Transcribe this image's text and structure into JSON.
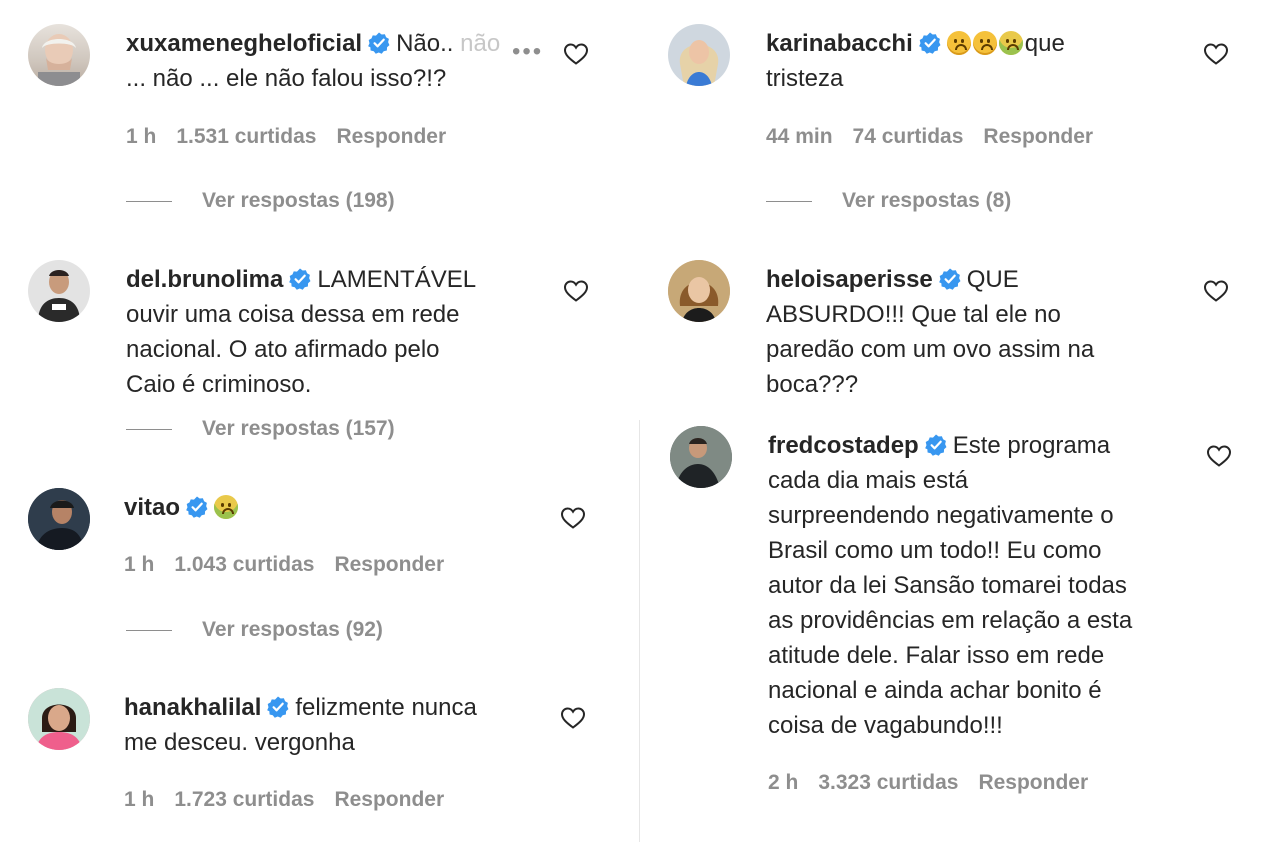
{
  "left": [
    {
      "username": "xuxamenegheloficial",
      "text_line1": "Não..",
      "text_faded": "não",
      "text_line2": "... não ... ele não falou isso?!?",
      "time": "1 h",
      "likes": "1.531 curtidas",
      "reply": "Responder",
      "replies": "Ver respostas (198)"
    },
    {
      "username": "del.brunolima",
      "text_line1": "LAMENTÁVEL",
      "text_line2": "ouvir uma coisa dessa em rede",
      "text_line3": "nacional. O ato afirmado pelo",
      "text_line4": "Caio é criminoso.",
      "replies": "Ver respostas (157)"
    },
    {
      "username": "vitao",
      "time": "1 h",
      "likes": "1.043 curtidas",
      "reply": "Responder",
      "replies": "Ver respostas (92)"
    },
    {
      "username": "hanakhalilal",
      "text_line1": "felizmente nunca",
      "text_line2": "me desceu. vergonha",
      "time": "1 h",
      "likes": "1.723 curtidas",
      "reply": "Responder"
    }
  ],
  "right": [
    {
      "username": "karinabacchi",
      "text_line1": "que",
      "text_line2": "tristeza",
      "time": "44 min",
      "likes": "74 curtidas",
      "reply": "Responder",
      "replies": "Ver respostas (8)"
    },
    {
      "username": "heloisaperisse",
      "text_line1": "QUE",
      "text_line2": "ABSURDO!!! Que tal ele no",
      "text_line3": "paredão com um ovo assim na",
      "text_line4": "boca???"
    },
    {
      "username": "fredcostadep",
      "text_line1": "Este programa",
      "text_line2": "cada dia mais está",
      "text_line3": "surpreendendo negativamente o",
      "text_line4": "Brasil como um todo!! Eu como",
      "text_line5": "autor da lei Sansão tomarei todas",
      "text_line6": "as providências em relação a esta",
      "text_line7": "atitude dele. Falar isso em rede",
      "text_line8": "nacional e ainda achar bonito é",
      "text_line9": "coisa de vagabundo!!!",
      "time": "2 h",
      "likes": "3.323 curtidas",
      "reply": "Responder"
    }
  ],
  "colors": {
    "verified": "#3897f0",
    "text": "#262626",
    "muted": "#8e8e8e"
  },
  "icons": [
    "verified-badge-icon",
    "heart-icon",
    "more-options-icon",
    "sad-face-emoji-icon",
    "sick-face-emoji-icon"
  ]
}
